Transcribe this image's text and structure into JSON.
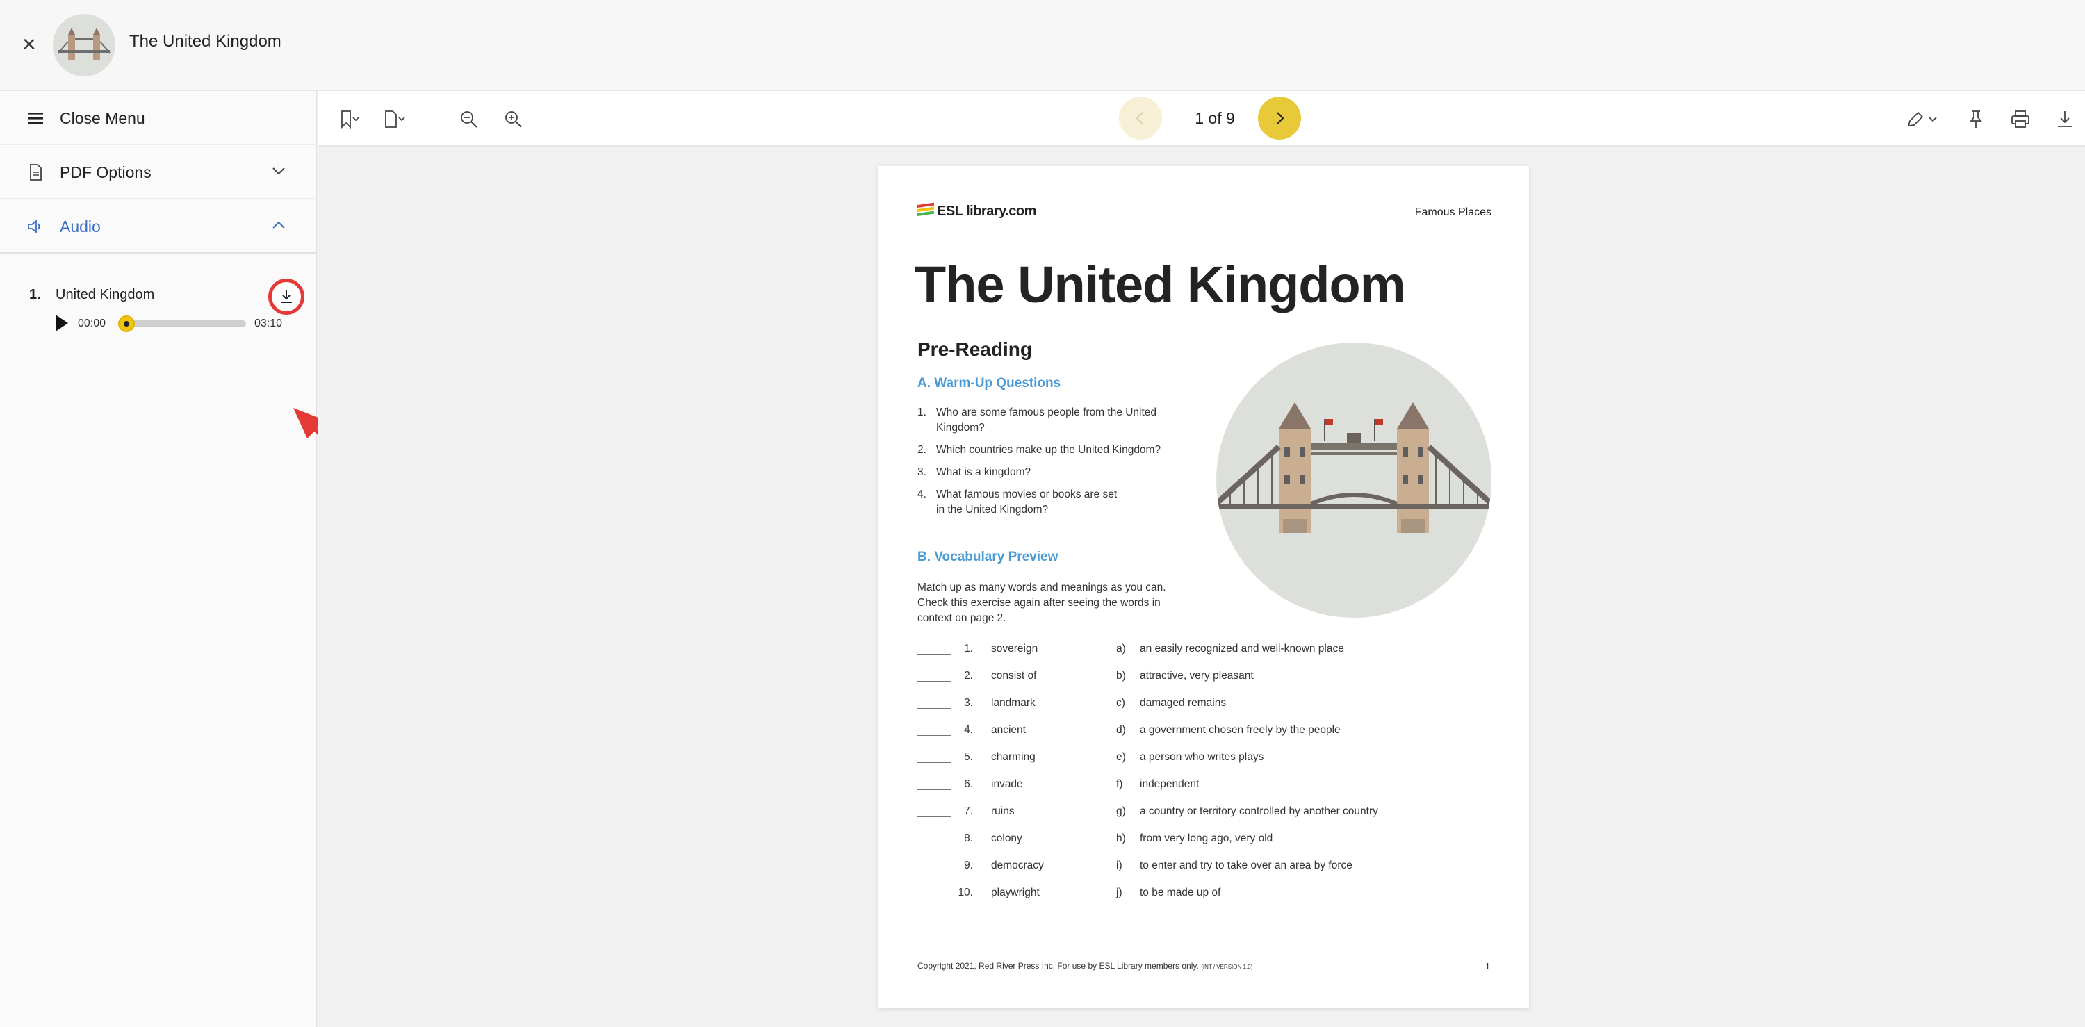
{
  "header": {
    "course_title": "The United Kingdom"
  },
  "sidebar": {
    "close_menu": "Close Menu",
    "pdf_options": "PDF Options",
    "audio": "Audio",
    "tracks": [
      {
        "number": "1.",
        "name": "United Kingdom",
        "current_time": "00:00",
        "duration": "03:10"
      }
    ]
  },
  "toolbar": {
    "page_indicator": "1 of 9"
  },
  "document": {
    "logo_text": "ESL library.com",
    "category": "Famous Places",
    "title": "The United Kingdom",
    "section_pre": "Pre-Reading",
    "warmup_heading": "A. Warm-Up Questions",
    "warmup": [
      {
        "n": "1.",
        "text": "Who are some famous people from the United Kingdom?"
      },
      {
        "n": "2.",
        "text": "Which countries make up the United Kingdom?"
      },
      {
        "n": "3.",
        "text": "What is a kingdom?"
      },
      {
        "n": "4.",
        "text": "What famous movies or books are set in the United Kingdom?"
      }
    ],
    "vocab_heading": "B. Vocabulary Preview",
    "vocab_instructions": "Match up as many words and meanings as you can. Check this exercise again after seeing the words in context on page 2.",
    "vocab": [
      {
        "n": "1.",
        "word": "sovereign",
        "letter": "a)",
        "def": "an easily recognized and well-known place"
      },
      {
        "n": "2.",
        "word": "consist of",
        "letter": "b)",
        "def": "attractive, very pleasant"
      },
      {
        "n": "3.",
        "word": "landmark",
        "letter": "c)",
        "def": "damaged remains"
      },
      {
        "n": "4.",
        "word": "ancient",
        "letter": "d)",
        "def": "a government chosen freely by the people"
      },
      {
        "n": "5.",
        "word": "charming",
        "letter": "e)",
        "def": "a person who writes plays"
      },
      {
        "n": "6.",
        "word": "invade",
        "letter": "f)",
        "def": "independent"
      },
      {
        "n": "7.",
        "word": "ruins",
        "letter": "g)",
        "def": "a country or territory controlled by another country"
      },
      {
        "n": "8.",
        "word": "colony",
        "letter": "h)",
        "def": "from very long ago, very old"
      },
      {
        "n": "9.",
        "word": "democracy",
        "letter": "i)",
        "def": "to enter and try to take over an area by force"
      },
      {
        "n": "10.",
        "word": "playwright",
        "letter": "j)",
        "def": "to be made up of"
      }
    ],
    "copyright": "Copyright 2021, Red River Press Inc. For use by ESL Library members only.",
    "version": "(INT / VERSION 1.0)",
    "page_number": "1"
  },
  "colors": {
    "accent_blue": "#3c6fc5",
    "nav_yellow": "#e8c93a",
    "annotation_red": "#e53935",
    "heading_blue": "#4a9ad4"
  },
  "audio_progress": 0
}
